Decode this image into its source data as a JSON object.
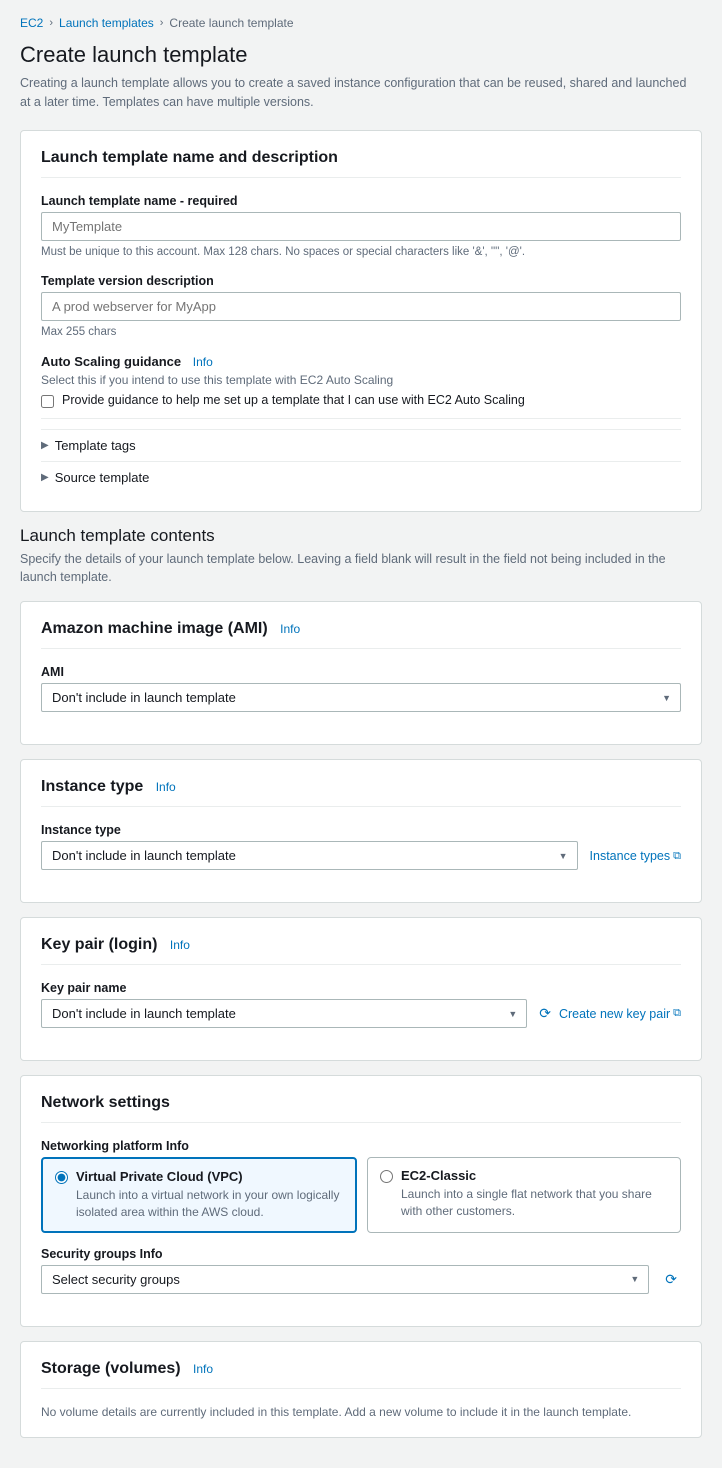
{
  "breadcrumb": {
    "items": [
      {
        "label": "EC2",
        "link": true
      },
      {
        "label": "Launch templates",
        "link": true
      },
      {
        "label": "Create launch template",
        "link": false
      }
    ],
    "separators": [
      ">",
      ">"
    ]
  },
  "page": {
    "title": "Create launch template",
    "description": "Creating a launch template allows you to create a saved instance configuration that can be reused, shared and launched at a later time. Templates can have multiple versions."
  },
  "name_description_section": {
    "title": "Launch template name and description",
    "name_label": "Launch template name - required",
    "name_placeholder": "MyTemplate",
    "name_hint": "Must be unique to this account. Max 128 chars. No spaces or special characters like '&', '\"', '@'.",
    "version_label": "Template version description",
    "version_placeholder": "A prod webserver for MyApp",
    "version_hint": "Max 255 chars",
    "auto_scaling_label": "Auto Scaling guidance",
    "auto_scaling_info": "Info",
    "auto_scaling_desc": "Select this if you intend to use this template with EC2 Auto Scaling",
    "auto_scaling_checkbox": "Provide guidance to help me set up a template that I can use with EC2 Auto Scaling",
    "template_tags_label": "Template tags",
    "source_template_label": "Source template"
  },
  "contents_section": {
    "title": "Launch template contents",
    "description": "Specify the details of your launch template below. Leaving a field blank will result in the field not being included in the launch template."
  },
  "ami_section": {
    "title": "Amazon machine image (AMI)",
    "info": "Info",
    "ami_label": "AMI",
    "ami_options": [
      "Don't include in launch template"
    ],
    "ami_selected": "Don't include in launch template"
  },
  "instance_type_section": {
    "title": "Instance type",
    "info": "Info",
    "instance_label": "Instance type",
    "instance_options": [
      "Don't include in launch template"
    ],
    "instance_selected": "Don't include in launch template",
    "instance_types_link": "Instance types"
  },
  "key_pair_section": {
    "title": "Key pair (login)",
    "info": "Info",
    "key_pair_label": "Key pair name",
    "key_pair_options": [
      "Don't include in launch template"
    ],
    "key_pair_selected": "Don't include in launch template",
    "create_link": "Create new key pair"
  },
  "network_section": {
    "title": "Network settings",
    "platform_label": "Networking platform",
    "platform_info": "Info",
    "options": [
      {
        "id": "vpc",
        "label": "Virtual Private Cloud (VPC)",
        "description": "Launch into a virtual network in your own logically isolated area within the AWS cloud.",
        "selected": true
      },
      {
        "id": "ec2-classic",
        "label": "EC2-Classic",
        "description": "Launch into a single flat network that you share with other customers.",
        "selected": false
      }
    ],
    "security_label": "Security groups",
    "security_info": "Info",
    "security_placeholder": "Select security groups"
  },
  "storage_section": {
    "title": "Storage (volumes)",
    "info": "Info",
    "hint": "No volume details are currently included in this template. Add a new volume to include it in the launch template."
  }
}
